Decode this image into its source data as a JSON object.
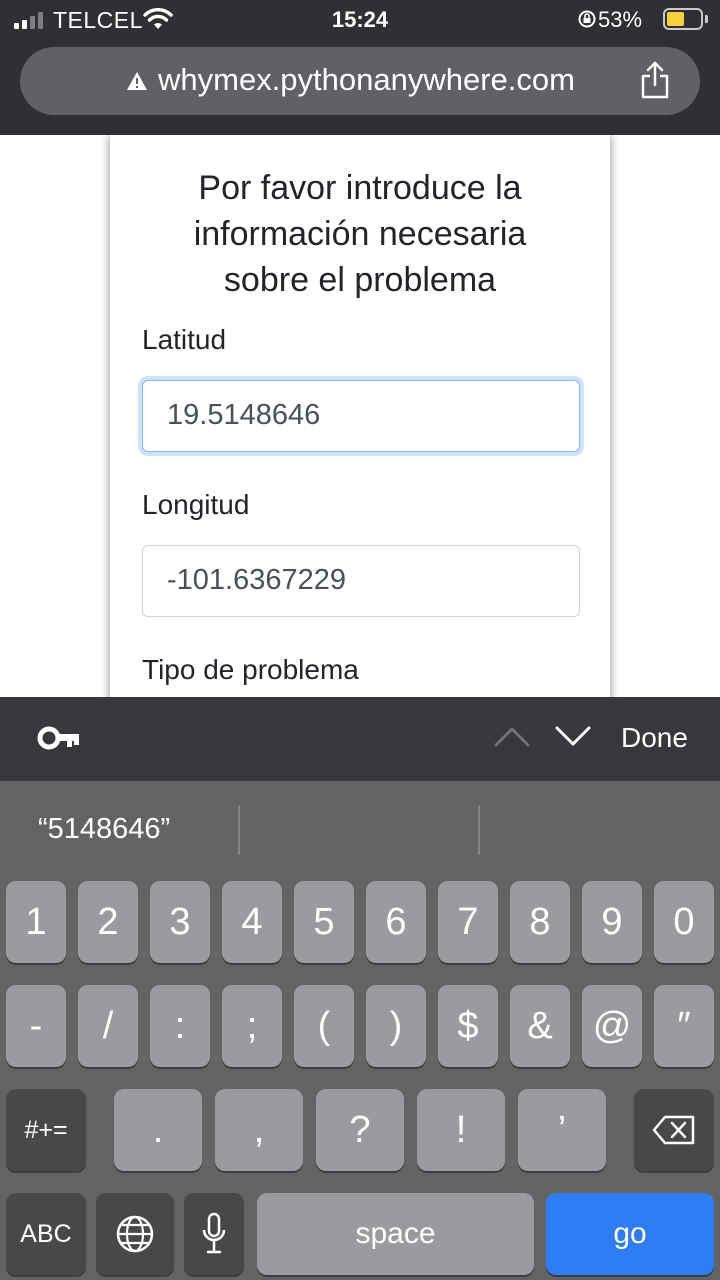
{
  "status": {
    "carrier": "TELCEL",
    "time": "15:24",
    "battery_percent": "53%",
    "battery_level": 0.53,
    "signal_bars": 2
  },
  "browser": {
    "url": "whymex.pythonanywhere.com",
    "security": "warning-icon",
    "share": "share-icon"
  },
  "form": {
    "title_lines": [
      "Por favor introduce la",
      "información necesaria",
      "sobre el problema"
    ],
    "latitude_label": "Latitud",
    "latitude_value": "19.5148646",
    "longitude_label": "Longitud",
    "longitude_value": "-101.6367229",
    "problem_type_label": "Tipo de problema"
  },
  "accessory_bar": {
    "key_icon": "key-icon",
    "done_label": "Done"
  },
  "keyboard": {
    "suggestion": "“5148646”",
    "row1": [
      "1",
      "2",
      "3",
      "4",
      "5",
      "6",
      "7",
      "8",
      "9",
      "0"
    ],
    "row2": [
      "-",
      "/",
      ":",
      ";",
      "(",
      ")",
      "$",
      "&",
      "@",
      "″"
    ],
    "row3": [
      ".",
      ",",
      "?",
      "!",
      "’"
    ],
    "symbols_label": "#+=",
    "abc_label": "ABC",
    "space_label": "space",
    "go_label": "go"
  },
  "colors": {
    "chrome": "#2f3033",
    "keyboard": "#626365",
    "key": "#9a9b9e",
    "go": "#2f7df6",
    "battery": "#f6d13a"
  }
}
